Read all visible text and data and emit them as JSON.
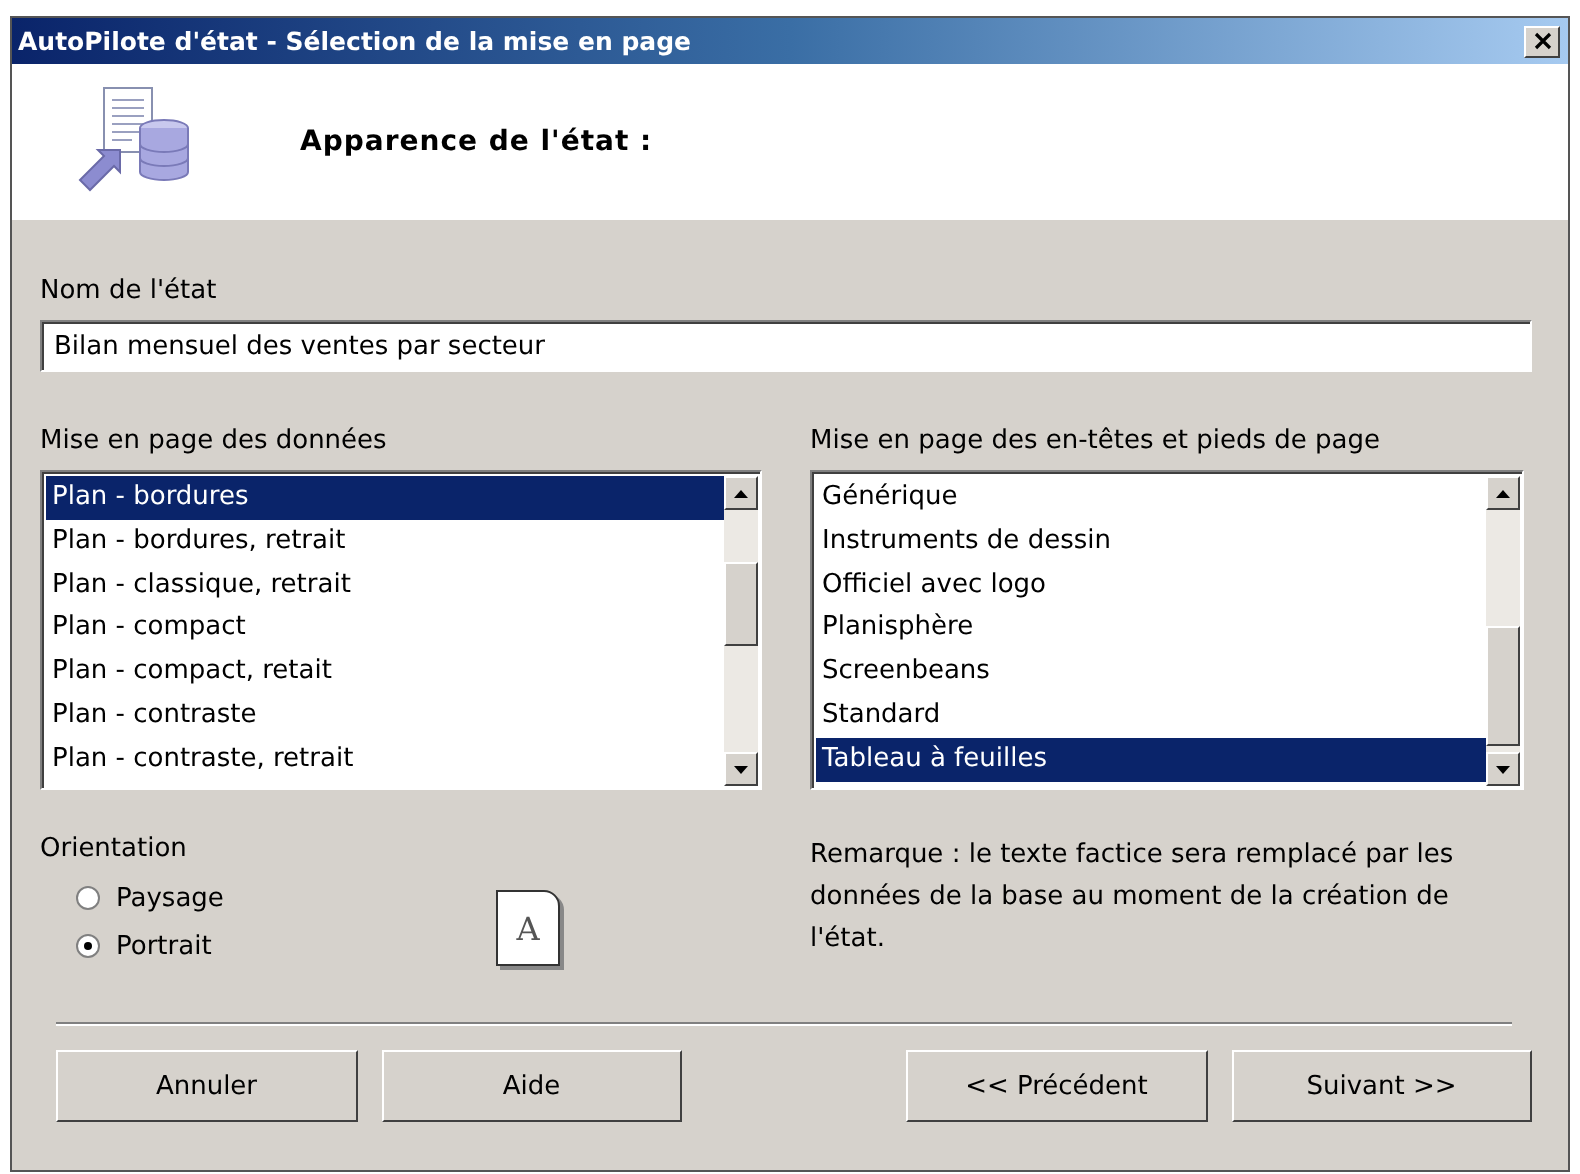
{
  "window": {
    "title": "AutoPilote d'état - Sélection de la mise en page"
  },
  "header": {
    "title": "Apparence de l'état :"
  },
  "report_name": {
    "label": "Nom de l'état",
    "value": "Bilan mensuel des ventes par secteur"
  },
  "data_layout": {
    "label": "Mise en page des données",
    "items": [
      {
        "label": "Plan - bordures",
        "selected": true
      },
      {
        "label": "Plan - bordures, retrait",
        "selected": false
      },
      {
        "label": "Plan - classique, retrait",
        "selected": false
      },
      {
        "label": "Plan - compact",
        "selected": false
      },
      {
        "label": "Plan - compact, retait",
        "selected": false
      },
      {
        "label": "Plan - contraste",
        "selected": false
      },
      {
        "label": "Plan - contraste, retrait",
        "selected": false
      }
    ]
  },
  "header_footer_layout": {
    "label": "Mise en page des en-têtes et pieds de page",
    "items": [
      {
        "label": "Générique",
        "selected": false
      },
      {
        "label": "Instruments de dessin",
        "selected": false
      },
      {
        "label": "Officiel avec logo",
        "selected": false
      },
      {
        "label": "Planisphère",
        "selected": false
      },
      {
        "label": "Screenbeans",
        "selected": false
      },
      {
        "label": "Standard",
        "selected": false
      },
      {
        "label": "Tableau à feuilles",
        "selected": true
      }
    ]
  },
  "orientation": {
    "label": "Orientation",
    "options": [
      {
        "label": "Paysage",
        "selected": false
      },
      {
        "label": "Portrait",
        "selected": true
      }
    ],
    "preview_letter": "A"
  },
  "note": "Remarque : le texte factice sera remplacé par les données de la base au moment de la création de l'état.",
  "buttons": [
    {
      "label": "Annuler"
    },
    {
      "label": "Aide"
    },
    {
      "label": "<< Précédent"
    },
    {
      "label": "Suivant >>"
    }
  ]
}
